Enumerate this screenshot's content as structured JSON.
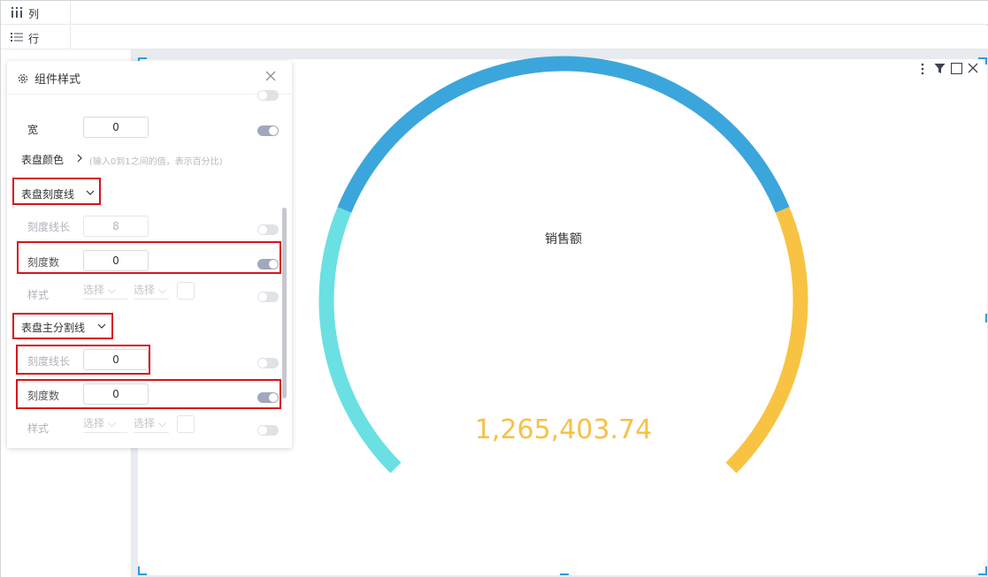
{
  "toolbar": {
    "columns_label": "列",
    "rows_label": "行",
    "columns_icon": "column-bars-icon",
    "rows_icon": "list-icon"
  },
  "panel": {
    "title": "组件样式",
    "width_label": "宽",
    "width_value": "0",
    "dial_color_label": "表盘颜色",
    "dial_color_hint": "(输入0到1之间的值，表示百分比)",
    "tick_section_label": "表盘刻度线",
    "tick_length_label": "刻度线长",
    "tick_length_value": "8",
    "tick_count_label": "刻度数",
    "tick_count_value": "0",
    "style_label": "样式",
    "select_placeholder_1": "选择",
    "select_placeholder_2": "选择",
    "main_split_section_label": "表盘主分割线",
    "split_length_label": "刻度线长",
    "split_length_value": "0",
    "split_count_label": "刻度数",
    "split_count_value": "0",
    "style2_label": "样式",
    "select2_placeholder_1": "选择",
    "select2_placeholder_2": "选择"
  },
  "chart_data": {
    "type": "gauge",
    "title": "销售额",
    "value_label": "1,265,403.74",
    "segments": [
      {
        "from": 0.0,
        "to": 0.25,
        "color": "#6ae0e3"
      },
      {
        "from": 0.25,
        "to": 0.75,
        "color": "#3ba6dc"
      },
      {
        "from": 0.75,
        "to": 1.0,
        "color": "#f8c343"
      }
    ]
  },
  "colors": {
    "accent_blue": "#3ba6dc",
    "accent_cyan": "#6ae0e3",
    "accent_yellow": "#f8c343",
    "highlight_red": "#d8141b"
  }
}
